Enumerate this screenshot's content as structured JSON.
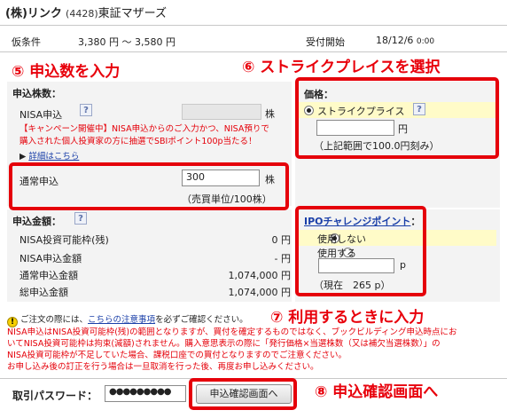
{
  "header": {
    "company": "(株)リンク",
    "code": "(4428)",
    "market": "東証マザーズ",
    "provisional_label": "仮条件",
    "provisional_value": "3,380 円 〜 3,580 円",
    "start_label": "受付開始",
    "start_value": "18/12/6",
    "start_time": "0:00"
  },
  "annotations": {
    "a5": "⑤ 申込数を入力",
    "a6": "⑥ ストライクプレイスを選択",
    "a7": "⑦ 利用するときに入力",
    "a8": "⑧ 申込確認画面へ"
  },
  "quantity": {
    "heading": "申込株数：",
    "help": "?",
    "nisa_label": "NISA申込",
    "unit": "株",
    "campaign_line1": "【キャンペーン開催中】NISA申込からのご入力かつ、NISA預りで",
    "campaign_line2": "購入された個人投資家の方に抽選でSBIポイント100p当たる！",
    "detail_link": "詳細はこちら",
    "normal_label": "通常申込",
    "normal_value": "300",
    "normal_unit": "株",
    "normal_note": "（売買単位/100株）"
  },
  "price": {
    "heading": "価格：",
    "strike_label": "ストライクプライス",
    "help": "?",
    "yen_unit": "円",
    "range_note": "（上記範囲で100.0円刻み）"
  },
  "amounts": {
    "heading": "申込金額：",
    "help": "?",
    "rows": [
      {
        "label": "NISA投資可能枠(残)",
        "value": "0 円"
      },
      {
        "label": "NISA申込金額",
        "value": "- 円"
      },
      {
        "label": "通常申込金額",
        "value": "1,074,000 円"
      },
      {
        "label": "総申込金額",
        "value": "1,074,000 円"
      }
    ]
  },
  "ipo_point": {
    "heading": "IPOチャレンジポイント",
    "colon": "：",
    "not_use": "使用しない",
    "use": "使用する",
    "p_unit": "p",
    "current": "（現在　265 p）"
  },
  "notice": {
    "pre": "ご注文の際には、",
    "link": "こちらの注意事項",
    "post": "を必ずご確認ください。",
    "line1": "NISA申込はNISA投資可能枠(残)の範囲となりますが、買付を確定するものではなく、ブックビルディング申込時点にお",
    "line2": "いてNISA投資可能枠は拘束(減額)されません。購入意思表示の際に「発行価格×当選株数（又は補欠当選株数）」の",
    "line3": "NISA投資可能枠が不足していた場合、課税口座での買付となりますのでご注意ください。",
    "line4": "お申し込み後の訂正を行う場合は一旦取消を行った後、再度お申し込みください。"
  },
  "footer": {
    "password_label": "取引パスワード：",
    "password_value": "●●●●●●●●●",
    "submit_label": "申込確認画面へ"
  },
  "colors": {
    "accent_red": "#e5000a",
    "link_blue": "#1a3fa8",
    "highlight_yellow": "#fffbc8"
  }
}
